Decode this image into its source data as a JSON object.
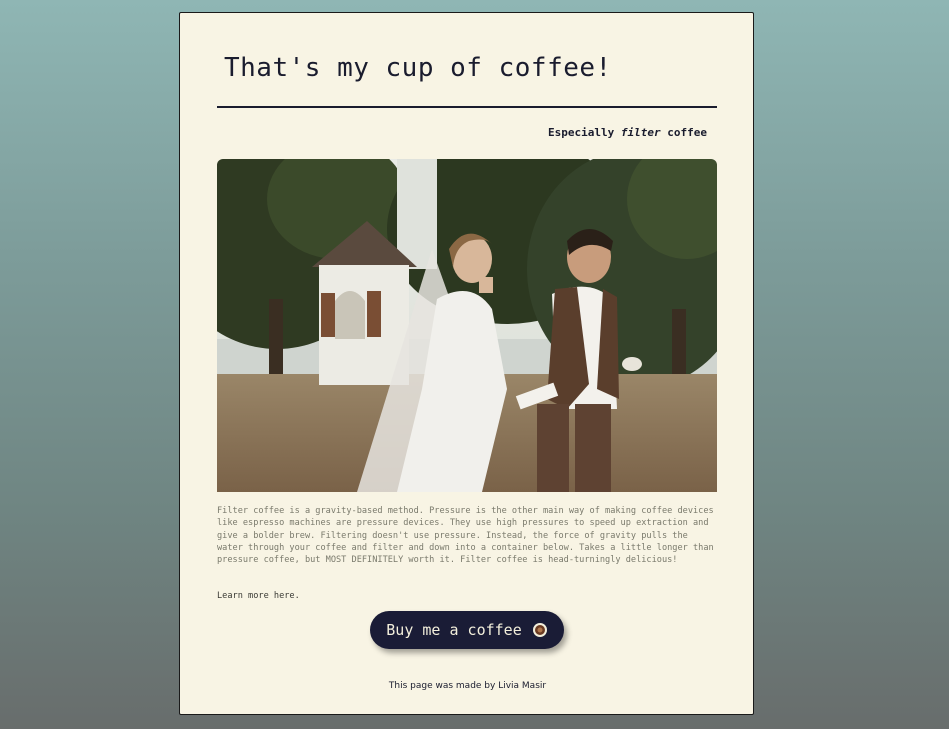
{
  "header": {
    "title": "That's my cup of coffee!",
    "subtitle_prefix": "Especially ",
    "subtitle_emphasis": "filter",
    "subtitle_suffix": " coffee"
  },
  "main": {
    "image_alt": "Couple walking and drinking coffee",
    "description": "Filter coffee is a gravity-based method. Pressure is the other main way of making coffee devices like espresso machines are pressure devices. They use high pressures to speed up extraction and give a bolder brew. Filtering doesn't use pressure. Instead, the force of gravity pulls the water through your coffee and filter and down into a container below. Takes a little longer than pressure coffee, but MOST DEFINITELY worth it. Filter coffee is head-turningly delicious!",
    "learn_more": "Learn more here.",
    "button_label": "Buy me a coffee",
    "button_icon": "coffee-cup-icon"
  },
  "footer": {
    "credit": "This page was made by Livia Masir"
  },
  "colors": {
    "card_bg": "#f8f4e4",
    "accent": "#1a1c36",
    "button_text": "#f3efdc"
  }
}
